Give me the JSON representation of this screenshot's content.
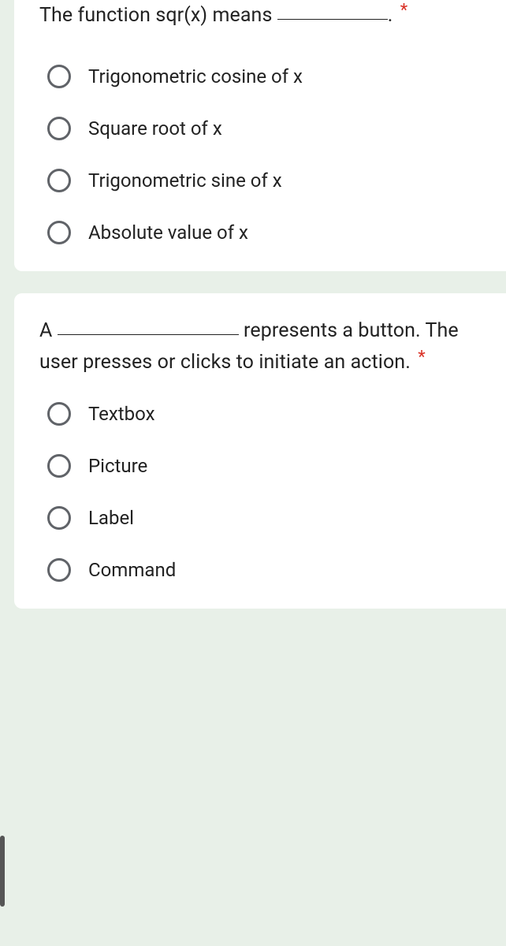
{
  "questions": [
    {
      "title_prefix": "The function sqr(x) means",
      "title_suffix": ".",
      "required_marker": "*",
      "options": [
        "Trigonometric cosine of x",
        "Square root of x",
        "Trigonometric sine of x",
        "Absolute value of x"
      ]
    },
    {
      "title_prefix": "A",
      "title_suffix": "represents a button. The user presses or clicks to initiate an action.",
      "required_marker": "*",
      "options": [
        "Textbox",
        "Picture",
        "Label",
        "Command"
      ]
    }
  ]
}
